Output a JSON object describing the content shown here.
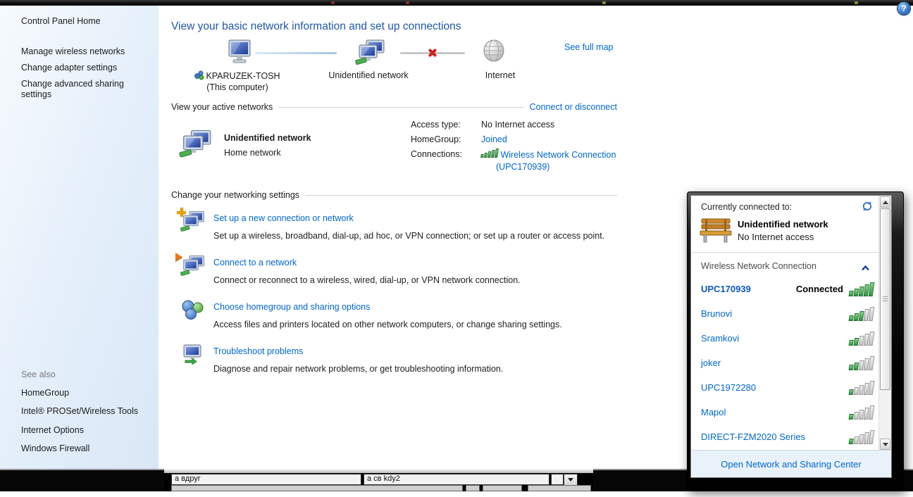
{
  "window": {
    "help_icon_glyph": "?"
  },
  "sidebar": {
    "home": "Control Panel Home",
    "tasks": [
      "Manage wireless networks",
      "Change adapter settings",
      "Change advanced sharing settings"
    ],
    "see_also_label": "See also",
    "see_also_links": [
      "HomeGroup",
      "Intel® PROSet/Wireless Tools",
      "Internet Options",
      "Windows Firewall"
    ]
  },
  "main": {
    "title": "View your basic network information and set up connections",
    "map": {
      "computer_name": "KPARUZEK-TOSH",
      "computer_sub": "(This computer)",
      "network_label": "Unidentified network",
      "internet_label": "Internet",
      "see_full_map": "See full map"
    },
    "active": {
      "section_label": "View your active networks",
      "connect_link": "Connect or disconnect",
      "network_name": "Unidentified network",
      "network_type": "Home network",
      "access_type_label": "Access type:",
      "access_type_value": "No Internet access",
      "homegroup_label": "HomeGroup:",
      "homegroup_value": "Joined",
      "connections_label": "Connections:",
      "connections_link_line1": "Wireless Network Connection",
      "connections_link_line2": "(UPC170939)",
      "connections_signal": 5
    },
    "settings": {
      "section_label": "Change your networking settings",
      "items": [
        {
          "icon": "new-connection-icon",
          "title": "Set up a new connection or network",
          "desc": "Set up a wireless, broadband, dial-up, ad hoc, or VPN connection; or set up a router or access point."
        },
        {
          "icon": "connect-network-icon",
          "title": "Connect to a network",
          "desc": "Connect or reconnect to a wireless, wired, dial-up, or VPN network connection."
        },
        {
          "icon": "homegroup-icon",
          "title": "Choose homegroup and sharing options",
          "desc": "Access files and printers located on other network computers, or change sharing settings."
        },
        {
          "icon": "troubleshoot-icon",
          "title": "Troubleshoot problems",
          "desc": "Diagnose and repair network problems, or get troubleshooting information."
        }
      ]
    }
  },
  "background_window": {
    "field1": "а вдруг",
    "field2": "а св kdy2",
    "dropdown_icon": "chevron-down-icon"
  },
  "popup": {
    "header": "Currently connected to:",
    "current_network": "Unidentified network",
    "current_status": "No Internet access",
    "section_label": "Wireless Network Connection",
    "networks": [
      {
        "name": "UPC170939",
        "status": "Connected",
        "signal": 5,
        "connected": true
      },
      {
        "name": "Brunovi",
        "signal": 3
      },
      {
        "name": "Sramkovi",
        "signal": 2
      },
      {
        "name": "joker",
        "signal": 2
      },
      {
        "name": "UPC1972280",
        "signal": 1
      },
      {
        "name": "Mapol",
        "signal": 1
      },
      {
        "name": "DIRECT-FZM2020 Series",
        "signal": 1
      }
    ],
    "footer_link": "Open Network and Sharing Center"
  },
  "colors": {
    "link": "#0066cc",
    "heading": "#2057a7",
    "signal_green": "#2f9140",
    "error_red": "#cf1f1f",
    "popup_footer_bg": "#e9f2fb",
    "sidebar_bg": "#e3eefa"
  }
}
